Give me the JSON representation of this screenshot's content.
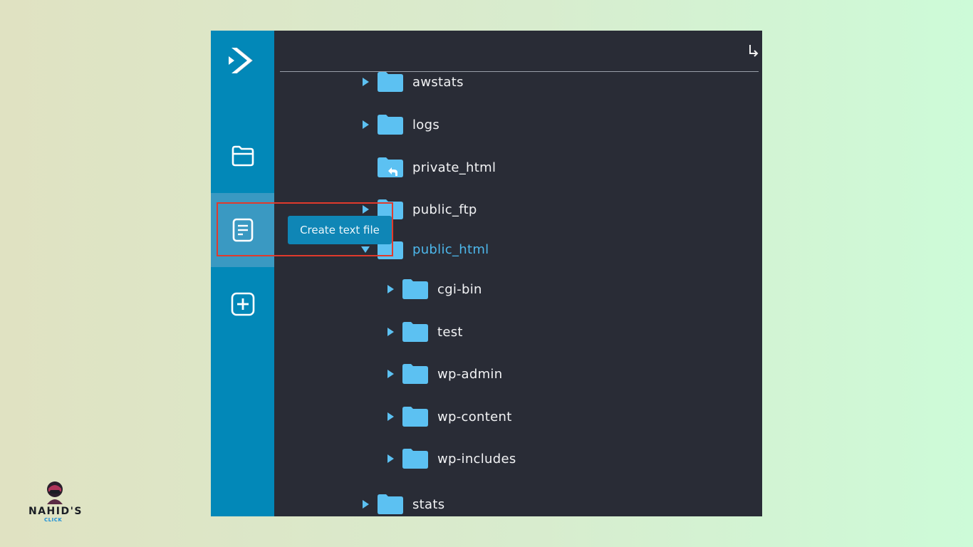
{
  "sidebar": {
    "logo": "double-chevron-logo-icon",
    "buttons": [
      {
        "icon": "folder-open-icon"
      },
      {
        "icon": "text-file-icon",
        "active": true
      },
      {
        "icon": "plus-square-icon"
      }
    ]
  },
  "topbar": {
    "return_icon": "return-arrow-icon"
  },
  "tooltip": {
    "text": "Create text file"
  },
  "tree": [
    {
      "name": "awstats",
      "caret": "collapsed"
    },
    {
      "name": "logs",
      "caret": "collapsed"
    },
    {
      "name": "private_html",
      "caret": "none",
      "link": true
    },
    {
      "name": "public_ftp",
      "caret": "collapsed"
    },
    {
      "name": "public_html",
      "caret": "expanded",
      "selected": true
    },
    {
      "name": "cgi-bin",
      "caret": "collapsed"
    },
    {
      "name": "test",
      "caret": "collapsed"
    },
    {
      "name": "wp-admin",
      "caret": "collapsed"
    },
    {
      "name": "wp-content",
      "caret": "collapsed"
    },
    {
      "name": "wp-includes",
      "caret": "collapsed"
    },
    {
      "name": "stats",
      "caret": "collapsed"
    }
  ],
  "colors": {
    "sidebar": "#0288b8",
    "panel": "#292c36",
    "folder": "#5cc1f2",
    "selected_text": "#4db8ec",
    "highlight_box": "#e03a2c"
  },
  "watermark": {
    "name": "NAHID'S",
    "sub": "CLICK"
  }
}
